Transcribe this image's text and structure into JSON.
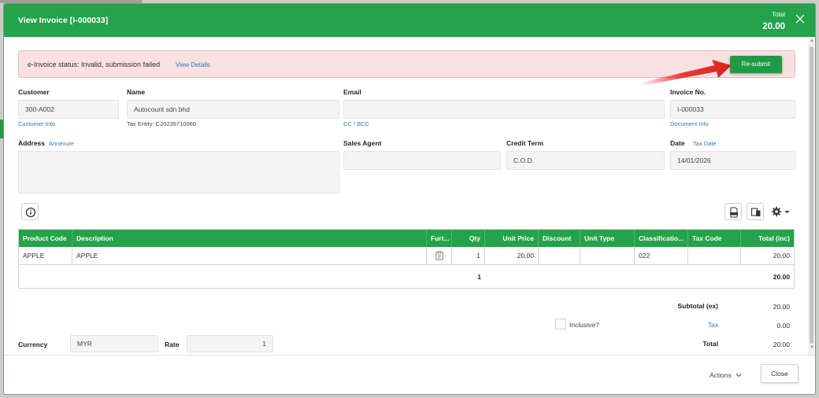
{
  "dialog": {
    "title": "View Invoice [I-000033]",
    "total_label": "Total",
    "total_value": "20.00"
  },
  "einvoice": {
    "status_text": "e-Invoice status: Invalid, submission failed",
    "view_details_link": "View Details",
    "resubmit_label": "Re-submit"
  },
  "customer": {
    "label": "Customer",
    "code": "300-A002",
    "info_link": "Customer Info"
  },
  "name": {
    "label": "Name",
    "value": "Autocount sdn bhd",
    "tax_entity": "Tax Entity: C20239710060"
  },
  "email": {
    "label": "Email",
    "value": "",
    "cc_link": "CC / BCC"
  },
  "invoice": {
    "label": "Invoice No.",
    "value": "I-000033",
    "doc_info_link": "Document Info"
  },
  "address": {
    "label": "Address",
    "annexure_link": "Annexure",
    "value": ""
  },
  "sales_agent": {
    "label": "Sales Agent",
    "value": ""
  },
  "credit_term": {
    "label": "Credit Term",
    "value": "C.O.D."
  },
  "date": {
    "label": "Date",
    "tax_date_link": "Tax Date",
    "value": "14/01/2026"
  },
  "grid": {
    "headers": [
      "Product Code",
      "Description",
      "Furt...",
      "Qty",
      "Unit Price",
      "Discount",
      "Unit Type",
      "Classificatio...",
      "Tax Code",
      "Total (inc)"
    ],
    "rows": [
      {
        "product_code": "APPLE",
        "description": "APPLE",
        "qty": "1",
        "unit_price": "20.00",
        "discount": "",
        "unit_type": "",
        "classification": "022",
        "tax_code": "",
        "total": "20.00"
      }
    ],
    "footer": {
      "qty_total": "1",
      "amount_total": "20.00"
    }
  },
  "summary": {
    "subtotal_label": "Subtotal (ex)",
    "subtotal_value": "20.00",
    "inclusive_label": "Inclusive?",
    "tax_label": "Tax",
    "tax_value": "0.00",
    "total_label": "Total",
    "total_value": "20.00"
  },
  "currency": {
    "label": "Currency",
    "value": "MYR",
    "rate_label": "Rate",
    "rate_value": "1"
  },
  "footer": {
    "actions_label": "Actions",
    "close_label": "Close"
  },
  "colors": {
    "header_green": "#23a34a",
    "error_bg": "#f9e1e1",
    "link_blue": "#2f73c6",
    "arrow_red": "#e0201c"
  }
}
